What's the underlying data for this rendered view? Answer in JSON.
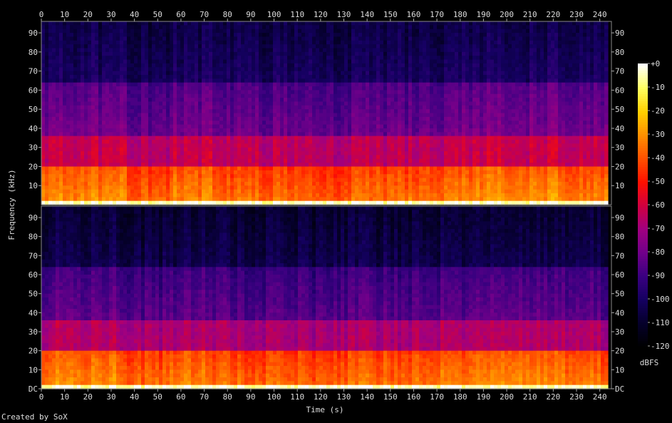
{
  "footer": {
    "credit": "Created by SoX"
  },
  "chart_data": {
    "type": "heatmap",
    "title": "",
    "xlabel": "Time (s)",
    "ylabel": "Frequency (kHz)",
    "xlim": [
      0,
      245
    ],
    "ylim": [
      0,
      96
    ],
    "x_ticks": [
      "0",
      "10",
      "20",
      "30",
      "40",
      "50",
      "60",
      "70",
      "80",
      "90",
      "100",
      "110",
      "120",
      "130",
      "140",
      "150",
      "160",
      "170",
      "180",
      "190",
      "200",
      "210",
      "220",
      "230",
      "240"
    ],
    "y_ticks": [
      "DC",
      "10",
      "20",
      "30",
      "40",
      "50",
      "60",
      "70",
      "80",
      "90"
    ],
    "channels": 2,
    "colorbar": {
      "label": "dBFS",
      "ticks": [
        "+0",
        "-10",
        "-20",
        "-30",
        "-40",
        "-50",
        "-60",
        "-70",
        "-80",
        "-90",
        "-100",
        "-110",
        "-120"
      ],
      "range": [
        -120,
        0
      ],
      "colors": [
        "#000000",
        "#05002a",
        "#140060",
        "#3a0080",
        "#70008a",
        "#a00080",
        "#d00040",
        "#ff1000",
        "#ff5000",
        "#ff9000",
        "#ffd000",
        "#ffff60",
        "#ffffff"
      ]
    },
    "segments": [
      {
        "start": 0,
        "end": 37,
        "loudness": 0.85
      },
      {
        "start": 37,
        "end": 55,
        "loudness": 0.6
      },
      {
        "start": 55,
        "end": 74,
        "loudness": 0.8
      },
      {
        "start": 74,
        "end": 112,
        "loudness": 0.6
      },
      {
        "start": 112,
        "end": 131,
        "loudness": 0.5
      },
      {
        "start": 131,
        "end": 168,
        "loudness": 0.65
      },
      {
        "start": 168,
        "end": 187,
        "loudness": 0.75
      },
      {
        "start": 187,
        "end": 225,
        "loudness": 0.9
      },
      {
        "start": 225,
        "end": 243,
        "loudness": 0.7
      }
    ]
  }
}
